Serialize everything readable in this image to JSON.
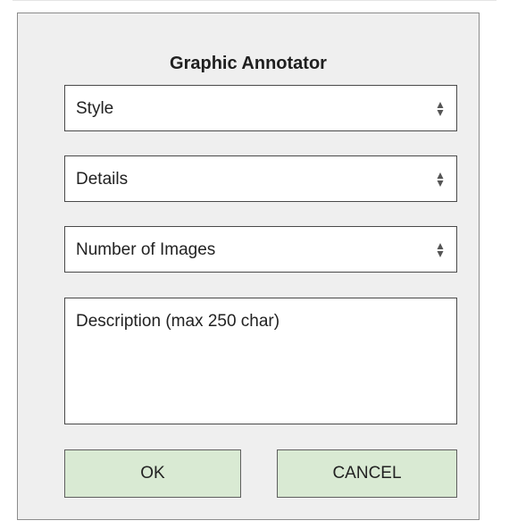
{
  "dialog": {
    "title": "Graphic Annotator",
    "fields": {
      "style": {
        "label": "Style",
        "icon": "select-arrows-icon"
      },
      "details": {
        "label": "Details",
        "icon": "select-arrows-icon"
      },
      "number_of_images": {
        "label": "Number of Images",
        "icon": "select-arrows-icon"
      }
    },
    "description": {
      "placeholder": "Description (max 250 char)"
    },
    "buttons": {
      "ok_label": "OK",
      "cancel_label": "CANCEL"
    },
    "colors": {
      "background": "#efefef",
      "button_fill": "#d9ead3",
      "border": "#4a4a4a"
    }
  }
}
